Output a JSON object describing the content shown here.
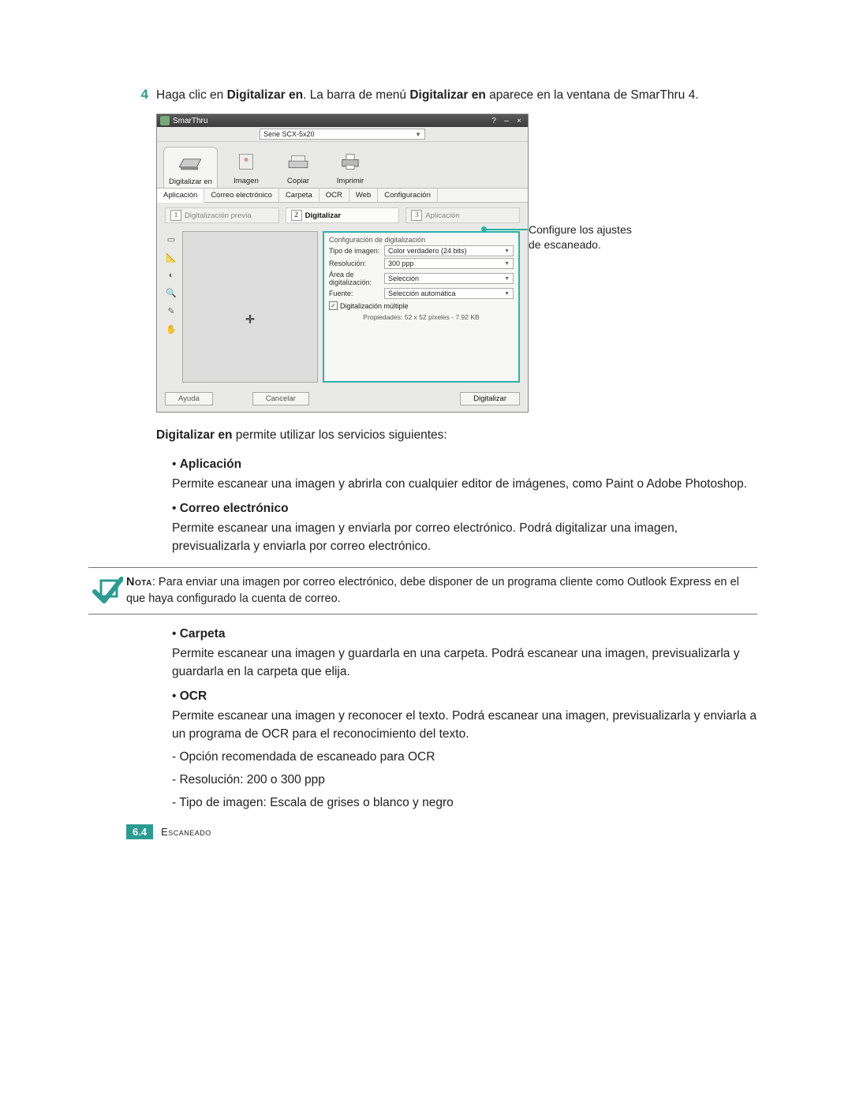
{
  "step": {
    "number": "4",
    "text_prefix": "Haga clic en ",
    "bold1": "Digitalizar en",
    "text_mid": ". La barra de menú ",
    "bold2": "Digitalizar en",
    "text_suffix": " aparece en la ventana de SmarThru 4."
  },
  "screenshot": {
    "title": "SmarThru",
    "device": "Serie SCX-5x20",
    "main_tabs": [
      "Digitalizar en",
      "Imagen",
      "Copiar",
      "Imprimir"
    ],
    "sub_tabs": [
      "Aplicación",
      "Correo electrónico",
      "Carpeta",
      "OCR",
      "Web",
      "Configuración"
    ],
    "step_tabs": [
      {
        "n": "1",
        "label": "Digitalización previa"
      },
      {
        "n": "2",
        "label": "Digitalizar"
      },
      {
        "n": "3",
        "label": "Aplicación"
      }
    ],
    "settings": {
      "caption": "Configuración de digitalización",
      "rows": [
        {
          "label": "Tipo de imagen:",
          "value": "Color verdadero (24 bits)"
        },
        {
          "label": "Resolución:",
          "value": "300 ppp"
        },
        {
          "label": "Área de digitalización:",
          "value": "Selección"
        },
        {
          "label": "Fuente:",
          "value": "Selección automática"
        }
      ],
      "checkbox": "Digitalización múltiple",
      "properties": "Propiedades: 52 x 52 píxeles - 7.92 KB"
    },
    "buttons": {
      "help": "Ayuda",
      "cancel": "Cancelar",
      "scan": "Digitalizar"
    }
  },
  "callout": "Configure los ajustes de escaneado.",
  "intro": {
    "bold": "Digitalizar en",
    "rest": " permite utilizar los servicios siguientes:"
  },
  "services": {
    "app": {
      "title": "Aplicación",
      "body": "Permite escanear una imagen y abrirla con cualquier editor de imágenes, como Paint o Adobe Photoshop."
    },
    "email": {
      "title": "Correo electrónico",
      "body": "Permite escanear una imagen y enviarla por correo electrónico. Podrá digitalizar una imagen, previsualizarla y enviarla por correo electrónico."
    },
    "folder": {
      "title": "Carpeta",
      "body": "Permite escanear una imagen y guardarla en una carpeta. Podrá escanear una imagen, previsualizarla y guardarla en la carpeta que elija."
    },
    "ocr": {
      "title": "OCR",
      "body": "Permite escanear una imagen y reconocer el texto. Podrá escanear una imagen, previsualizarla y enviarla a un programa de OCR para el reconocimiento del texto."
    }
  },
  "note": {
    "label": "Nota",
    "text": ": Para enviar una imagen por correo electrónico, debe disponer de un programa cliente como Outlook Express en el que haya configurado la cuenta de correo."
  },
  "ocr_tips": [
    "Opción recomendada de escaneado para OCR",
    "Resolución: 200 o 300 ppp",
    "Tipo de imagen: Escala de grises o blanco y negro"
  ],
  "footer": {
    "page": "6.4",
    "section": "Escaneado"
  }
}
